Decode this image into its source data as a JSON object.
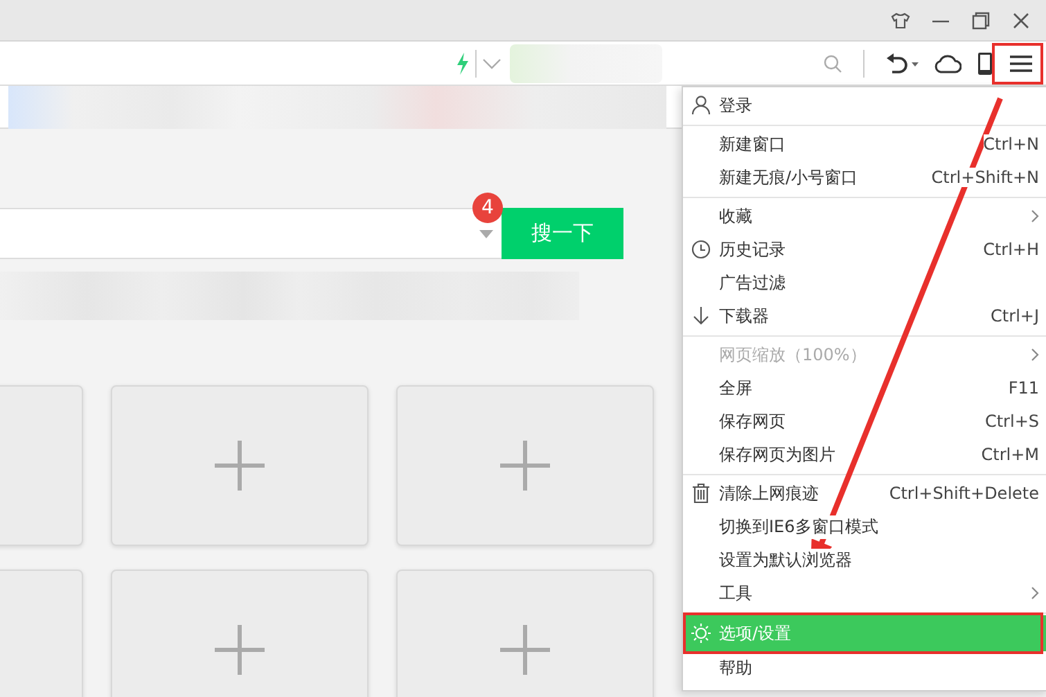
{
  "search": {
    "button": "搜一下",
    "badge": "4"
  },
  "menu": {
    "groups": [
      [
        {
          "label": "登录",
          "selected": false,
          "disabled": false,
          "submenu": false
        }
      ],
      [
        {
          "label": "新建窗口",
          "shortcut": "Ctrl+N",
          "selected": false,
          "disabled": false,
          "submenu": false
        },
        {
          "label": "新建无痕/小号窗口",
          "shortcut": "Ctrl+Shift+N",
          "selected": false,
          "disabled": false,
          "submenu": false
        }
      ],
      [
        {
          "label": "收藏",
          "selected": false,
          "disabled": false,
          "submenu": true
        },
        {
          "label": "历史记录",
          "shortcut": "Ctrl+H",
          "selected": false,
          "disabled": false,
          "submenu": false
        },
        {
          "label": "广告过滤",
          "selected": false,
          "disabled": false,
          "submenu": false
        },
        {
          "label": "下载器",
          "shortcut": "Ctrl+J",
          "selected": false,
          "disabled": false,
          "submenu": false
        }
      ],
      [
        {
          "label": "网页缩放（100%）",
          "selected": false,
          "disabled": true,
          "submenu": true
        },
        {
          "label": "全屏",
          "shortcut": "F11",
          "selected": false,
          "disabled": false,
          "submenu": false
        },
        {
          "label": "保存网页",
          "shortcut": "Ctrl+S",
          "selected": false,
          "disabled": false,
          "submenu": false
        },
        {
          "label": "保存网页为图片",
          "shortcut": "Ctrl+M",
          "selected": false,
          "disabled": false,
          "submenu": false
        }
      ],
      [
        {
          "label": "清除上网痕迹",
          "shortcut": "Ctrl+Shift+Delete",
          "selected": false,
          "disabled": false,
          "submenu": false
        },
        {
          "label": "切换到IE6多窗口模式",
          "selected": false,
          "disabled": false,
          "submenu": false
        },
        {
          "label": "设置为默认浏览器",
          "selected": false,
          "disabled": false,
          "submenu": false
        },
        {
          "label": "工具",
          "selected": false,
          "disabled": false,
          "submenu": true
        }
      ],
      [
        {
          "label": "选项/设置",
          "selected": true,
          "disabled": false,
          "submenu": false
        },
        {
          "label": "帮助",
          "selected": false,
          "disabled": false,
          "submenu": false
        }
      ]
    ]
  },
  "annotations": [
    {
      "kind": "menu_button_frame"
    },
    {
      "kind": "selected_item_frame"
    },
    {
      "kind": "arrow"
    }
  ]
}
